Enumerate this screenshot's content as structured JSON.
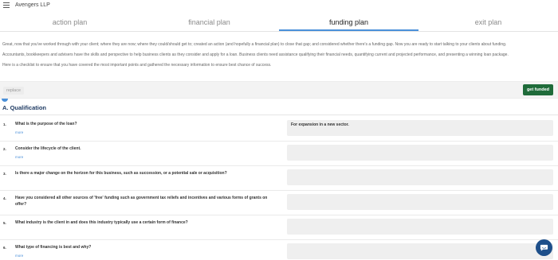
{
  "header": {
    "company_name": "Avengers LLP",
    "menu_icon": "hamburger-menu-icon"
  },
  "tabs": [
    {
      "label": "action plan",
      "active": false
    },
    {
      "label": "financial plan",
      "active": false
    },
    {
      "label": "funding plan",
      "active": true
    },
    {
      "label": "exit plan",
      "active": false
    }
  ],
  "intro": {
    "paragraph_1": "Great, now that you've worked through with your client; where they are now; where they could/should get to; created an action (and hopefully a financial plan) to close that gap; and considered whether there's a funding gap. Now you are ready to start talking to your clients about funding.",
    "paragraph_2": "Accountants, bookkeepers and advisers have the skills and perspective to help business clients as they consider and apply for a loan. Business clients need assistance qualifying their financial needs, quantifying current and projected performance, and presenting a winning loan package.",
    "paragraph_3": "Here is a checklist to ensure that you have covered the most important points and gathered the necessary information to ensure best chance of success."
  },
  "actions": {
    "replace_label": "replace",
    "get_funded_label": "get funded"
  },
  "section": {
    "title": "A. Qualification"
  },
  "questions": [
    {
      "num": "1.",
      "text": "What is the purpose of the loan?",
      "more": "more",
      "answer": "For expansion in a new sector."
    },
    {
      "num": "2.",
      "text": "Consider the lifecycle of the client.",
      "more": "more",
      "answer": ""
    },
    {
      "num": "3.",
      "text": "Is there a major change on the horizon for this business, such as succession, or a potential sale or acquisition?",
      "more": "",
      "answer": ""
    },
    {
      "num": "4.",
      "text": "Have you considered all other sources of 'free' funding such as government tax reliefs and incentives and various forms of grants on offer?",
      "more": "",
      "answer": ""
    },
    {
      "num": "5.",
      "text": "What industry is the client in and does this industry typically use a certain form of finance?",
      "more": "",
      "answer": ""
    },
    {
      "num": "6.",
      "text": "What type of financing is best and why?",
      "more": "more",
      "answer": ""
    }
  ],
  "colors": {
    "accent": "#4a90d9",
    "primary_button": "#1f6b3a",
    "section_title": "#1f3b63",
    "chat_button": "#1e4f8a"
  },
  "chat": {
    "icon": "chat-bubble-icon"
  }
}
